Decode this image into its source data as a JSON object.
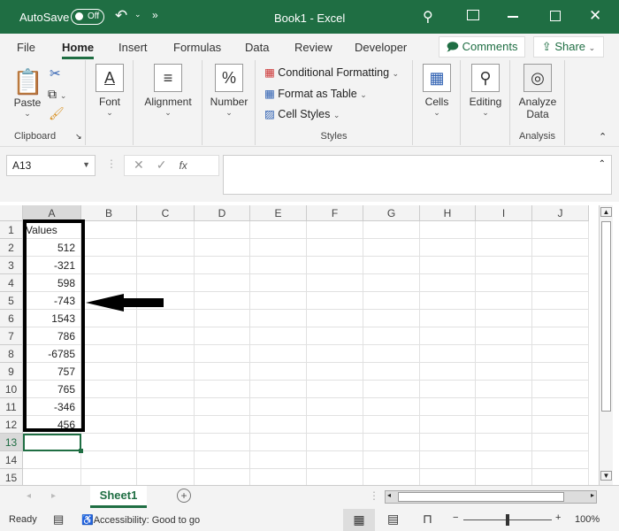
{
  "title": {
    "autosave": "AutoSave",
    "toggle": "Off",
    "doc": "Book1 - Excel"
  },
  "tabs": [
    "File",
    "Home",
    "Insert",
    "Formulas",
    "Data",
    "Review",
    "Developer"
  ],
  "comments": "Comments",
  "share": "Share",
  "ribbon": {
    "paste": "Paste",
    "clipboard": "Clipboard",
    "font": "Font",
    "alignment": "Alignment",
    "number": "Number",
    "cond": "Conditional Formatting",
    "table": "Format as Table",
    "styles_btn": "Cell Styles",
    "styles": "Styles",
    "cells": "Cells",
    "editing": "Editing",
    "analyze1": "Analyze",
    "analyze2": "Data",
    "analysis": "Analysis"
  },
  "namebox": "A13",
  "fx": "fx",
  "columns": [
    "A",
    "B",
    "C",
    "D",
    "E",
    "F",
    "G",
    "H",
    "I",
    "J"
  ],
  "rows": [
    "1",
    "2",
    "3",
    "4",
    "5",
    "6",
    "7",
    "8",
    "9",
    "10",
    "11",
    "12",
    "13",
    "14",
    "15"
  ],
  "header": "Values",
  "values": [
    "512",
    "-321",
    "598",
    "-743",
    "1543",
    "786",
    "-6785",
    "757",
    "765",
    "-346",
    "456"
  ],
  "sheet": "Sheet1",
  "status": {
    "ready": "Ready",
    "access": "Accessibility: Good to go",
    "zoom": "100%"
  },
  "colors": {
    "accent": "#1f6e43"
  }
}
